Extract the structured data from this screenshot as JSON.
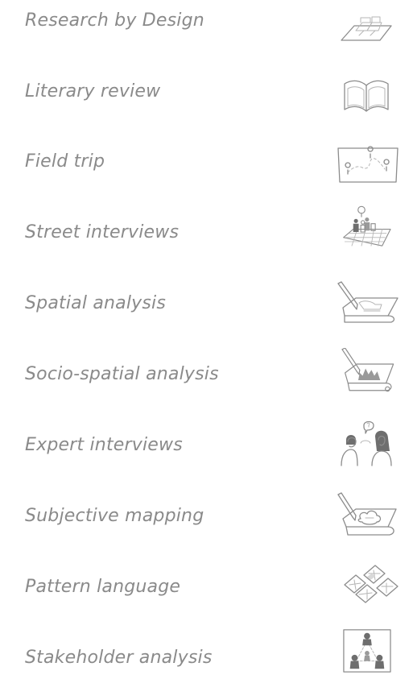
{
  "methods": [
    {
      "label": "Research by Design",
      "icon": "model-blocks-icon"
    },
    {
      "label": "Literary review",
      "icon": "open-book-icon"
    },
    {
      "label": "Field trip",
      "icon": "map-route-icon"
    },
    {
      "label": "Street interviews",
      "icon": "people-on-grid-icon"
    },
    {
      "label": "Spatial analysis",
      "icon": "pen-drawing-plan-icon"
    },
    {
      "label": "Socio-spatial analysis",
      "icon": "pen-drawing-chart-icon"
    },
    {
      "label": "Expert interviews",
      "icon": "two-people-talking-icon"
    },
    {
      "label": "Subjective mapping",
      "icon": "pen-drawing-idea-icon"
    },
    {
      "label": "Pattern language",
      "icon": "pattern-cards-icon"
    },
    {
      "label": "Stakeholder analysis",
      "icon": "stakeholder-network-icon"
    }
  ],
  "colors": {
    "label_text": "#8a8a8a",
    "icon_stroke": "#8c8c8c",
    "background": "#ffffff"
  }
}
